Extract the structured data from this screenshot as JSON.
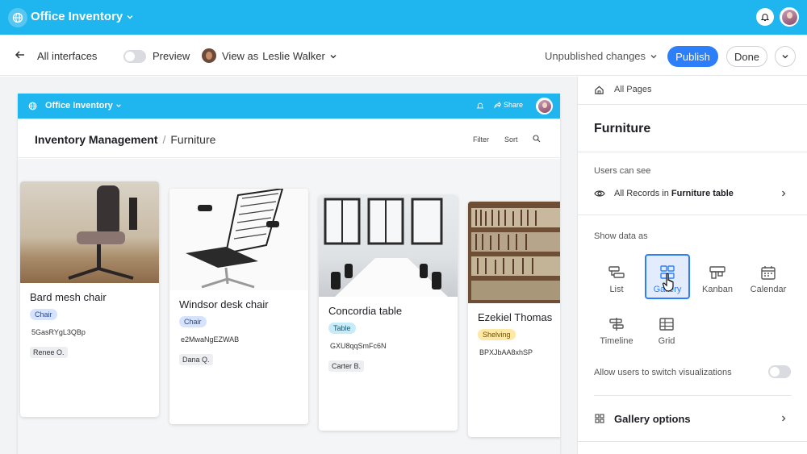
{
  "app": {
    "title": "Office Inventory"
  },
  "subbar": {
    "back_label": "All interfaces",
    "preview_label": "Preview",
    "view_as_prefix": "View as",
    "view_as_user": "Leslie Walker",
    "unpublished_label": "Unpublished changes",
    "publish_label": "Publish",
    "done_label": "Done"
  },
  "preview": {
    "app_title": "Office Inventory",
    "share_label": "Share",
    "breadcrumb": {
      "root": "Inventory Management",
      "separator": "/",
      "page": "Furniture"
    },
    "filter_label": "Filter",
    "sort_label": "Sort",
    "cards": [
      {
        "title": "Bard mesh chair",
        "tag": "Chair",
        "sku": "5GasRYgL3QBp",
        "user": "Renee O."
      },
      {
        "title": "Windsor desk chair",
        "tag": "Chair",
        "sku": "e2MwaNgEZWAB",
        "user": "Dana Q."
      },
      {
        "title": "Concordia table",
        "tag": "Table",
        "sku": "GXU8qqSmFc6N",
        "user": "Carter B."
      },
      {
        "title": "Ezekiel Thomas",
        "tag": "Shelving",
        "sku": "BPXJbAA8xhSP",
        "user": ""
      }
    ]
  },
  "panel": {
    "breadcrumb": "All Pages",
    "title": "Furniture",
    "users_can_see_label": "Users can see",
    "records_prefix": "All Records in",
    "records_table": "Furniture table",
    "show_data_label": "Show data as",
    "viz_options": [
      {
        "label": "List",
        "icon": "list-icon"
      },
      {
        "label": "Gallery",
        "icon": "gallery-icon",
        "selected": true
      },
      {
        "label": "Kanban",
        "icon": "kanban-icon"
      },
      {
        "label": "Calendar",
        "icon": "calendar-icon"
      },
      {
        "label": "Timeline",
        "icon": "timeline-icon"
      },
      {
        "label": "Grid",
        "icon": "grid-icon"
      }
    ],
    "allow_switch_label": "Allow users to switch visualizations",
    "gallery_options_label": "Gallery options"
  },
  "colors": {
    "topbar": "#1fb5ee",
    "accent": "#2d7ff9"
  }
}
